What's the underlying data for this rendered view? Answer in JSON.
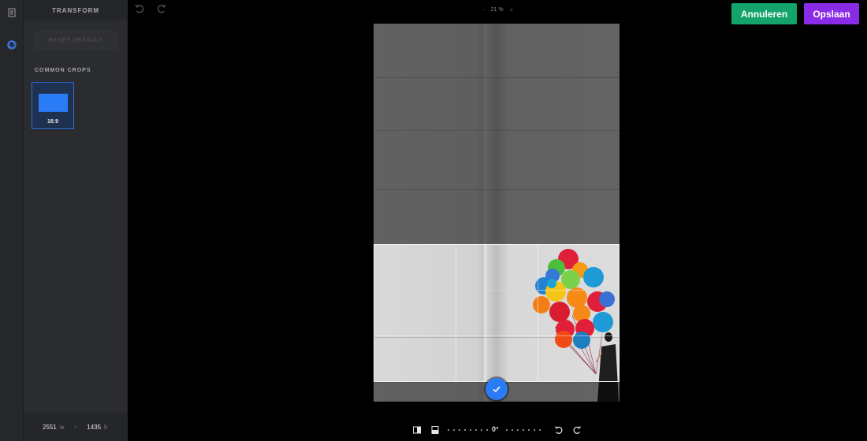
{
  "panel": {
    "title": "TRANSFORM",
    "reset_label": "RESET DEFAULT",
    "section_title": "COMMON CROPS",
    "crops": [
      {
        "label": "16:9"
      }
    ]
  },
  "size": {
    "width_value": "2551",
    "width_unit": "w",
    "separator": "×",
    "height_value": "1435",
    "height_unit": "h"
  },
  "toolbar": {
    "zoom_minus": "-",
    "zoom_value": "21 %",
    "zoom_plus": "+"
  },
  "actions": {
    "cancel_label": "Annuleren",
    "save_label": "Opslaan"
  },
  "rotation": {
    "value": "0°"
  },
  "icons": {
    "rail": [
      "document-icon",
      "crop-transform-icon"
    ],
    "top": [
      "undo-icon",
      "redo-icon"
    ],
    "bottom": [
      "flip-horizontal-icon",
      "flip-vertical-icon",
      "rotate-left-icon",
      "rotate-right-icon"
    ],
    "confirm": "checkmark-icon"
  },
  "colors": {
    "cancel": "#13a36b",
    "save": "#8a2be8",
    "accent": "#2a7bf6"
  }
}
